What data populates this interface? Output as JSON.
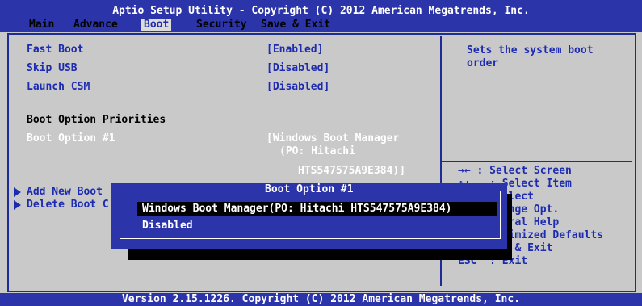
{
  "header": {
    "title": "Aptio Setup Utility - Copyright (C) 2012 American Megatrends, Inc.",
    "menu": [
      "Main",
      "Advance",
      "Boot",
      "Security",
      "Save & Exit"
    ]
  },
  "settings": {
    "fast_boot": {
      "label": "Fast Boot",
      "value": "[Enabled]"
    },
    "skip_usb": {
      "label": "Skip USB",
      "value": "[Disabled]"
    },
    "launch_csm": {
      "label": "Launch CSM",
      "value": "[Disabled]"
    },
    "priorities_heading": "Boot Option Priorities",
    "boot_option_1": {
      "label": "Boot Option #1",
      "value_line1": "[Windows Boot Manager",
      "value_line2": "(PO: Hitachi",
      "value_line3": "HTS547575A9E384)]"
    },
    "add_new_boot": "Add New Boot",
    "delete_boot": "Delete Boot C"
  },
  "help_panel": {
    "description_line1": "Sets the system boot",
    "description_line2": "order",
    "keys": [
      "→← : Select Screen",
      "↑↓   : Select Item",
      "       elect",
      "       ange Opt.",
      "       eral Help",
      "       timized Defaults",
      "       e & Exit",
      "ESC  : Exit"
    ]
  },
  "popup": {
    "title": "Boot Option #1",
    "options": [
      "Windows Boot Manager(PO: Hitachi HTS547575A9E384)",
      "Disabled"
    ]
  },
  "footer": {
    "version": "Version 2.15.1226. Copyright (C) 2012 American Megatrends, Inc."
  }
}
